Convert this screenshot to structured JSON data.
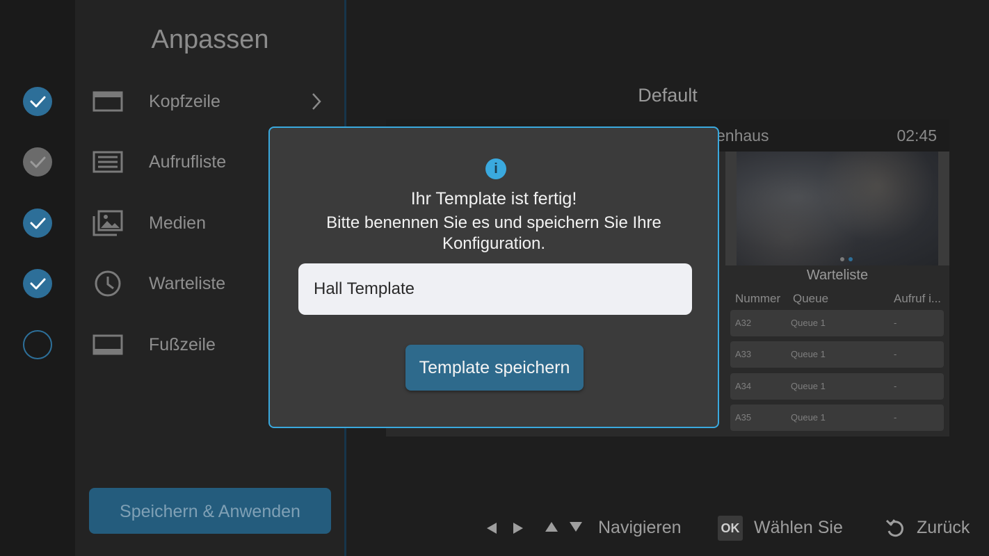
{
  "sidebar": {
    "title": "Anpassen",
    "items": [
      {
        "label": "Kopfzeile",
        "icon": "header-layout-icon",
        "state": "done"
      },
      {
        "label": "Aufrufliste",
        "icon": "list-icon",
        "state": "skipped"
      },
      {
        "label": "Medien",
        "icon": "images-icon",
        "state": "done"
      },
      {
        "label": "Warteliste",
        "icon": "clock-icon",
        "state": "done"
      },
      {
        "label": "Fußzeile",
        "icon": "footer-layout-icon",
        "state": "pending"
      }
    ],
    "save_button": "Speichern & Anwenden"
  },
  "main": {
    "template_name": "Default",
    "preview": {
      "brand_partial": "enhaus",
      "clock": "02:45",
      "queue_title": "Warteliste",
      "columns": [
        "Nummer",
        "Queue",
        "Aufruf i..."
      ],
      "rows": [
        [
          "A32",
          "Queue 1",
          "-"
        ],
        [
          "A33",
          "Queue 1",
          "-"
        ],
        [
          "A34",
          "Queue 1",
          "-"
        ],
        [
          "A35",
          "Queue 1",
          "-"
        ]
      ]
    }
  },
  "dialog": {
    "title": "Ihr Template ist fertig!",
    "message": "Bitte benennen Sie es und speichern Sie Ihre Konfiguration.",
    "input_value": "Hall Template",
    "save_button": "Template speichern"
  },
  "bottom_bar": {
    "navigate": "Navigieren",
    "ok_key": "OK",
    "select": "Wählen Sie",
    "back": "Zurück"
  },
  "colors": {
    "accent": "#3aa9de",
    "button": "#2e6a8c",
    "step_done": "#2d6f99"
  }
}
